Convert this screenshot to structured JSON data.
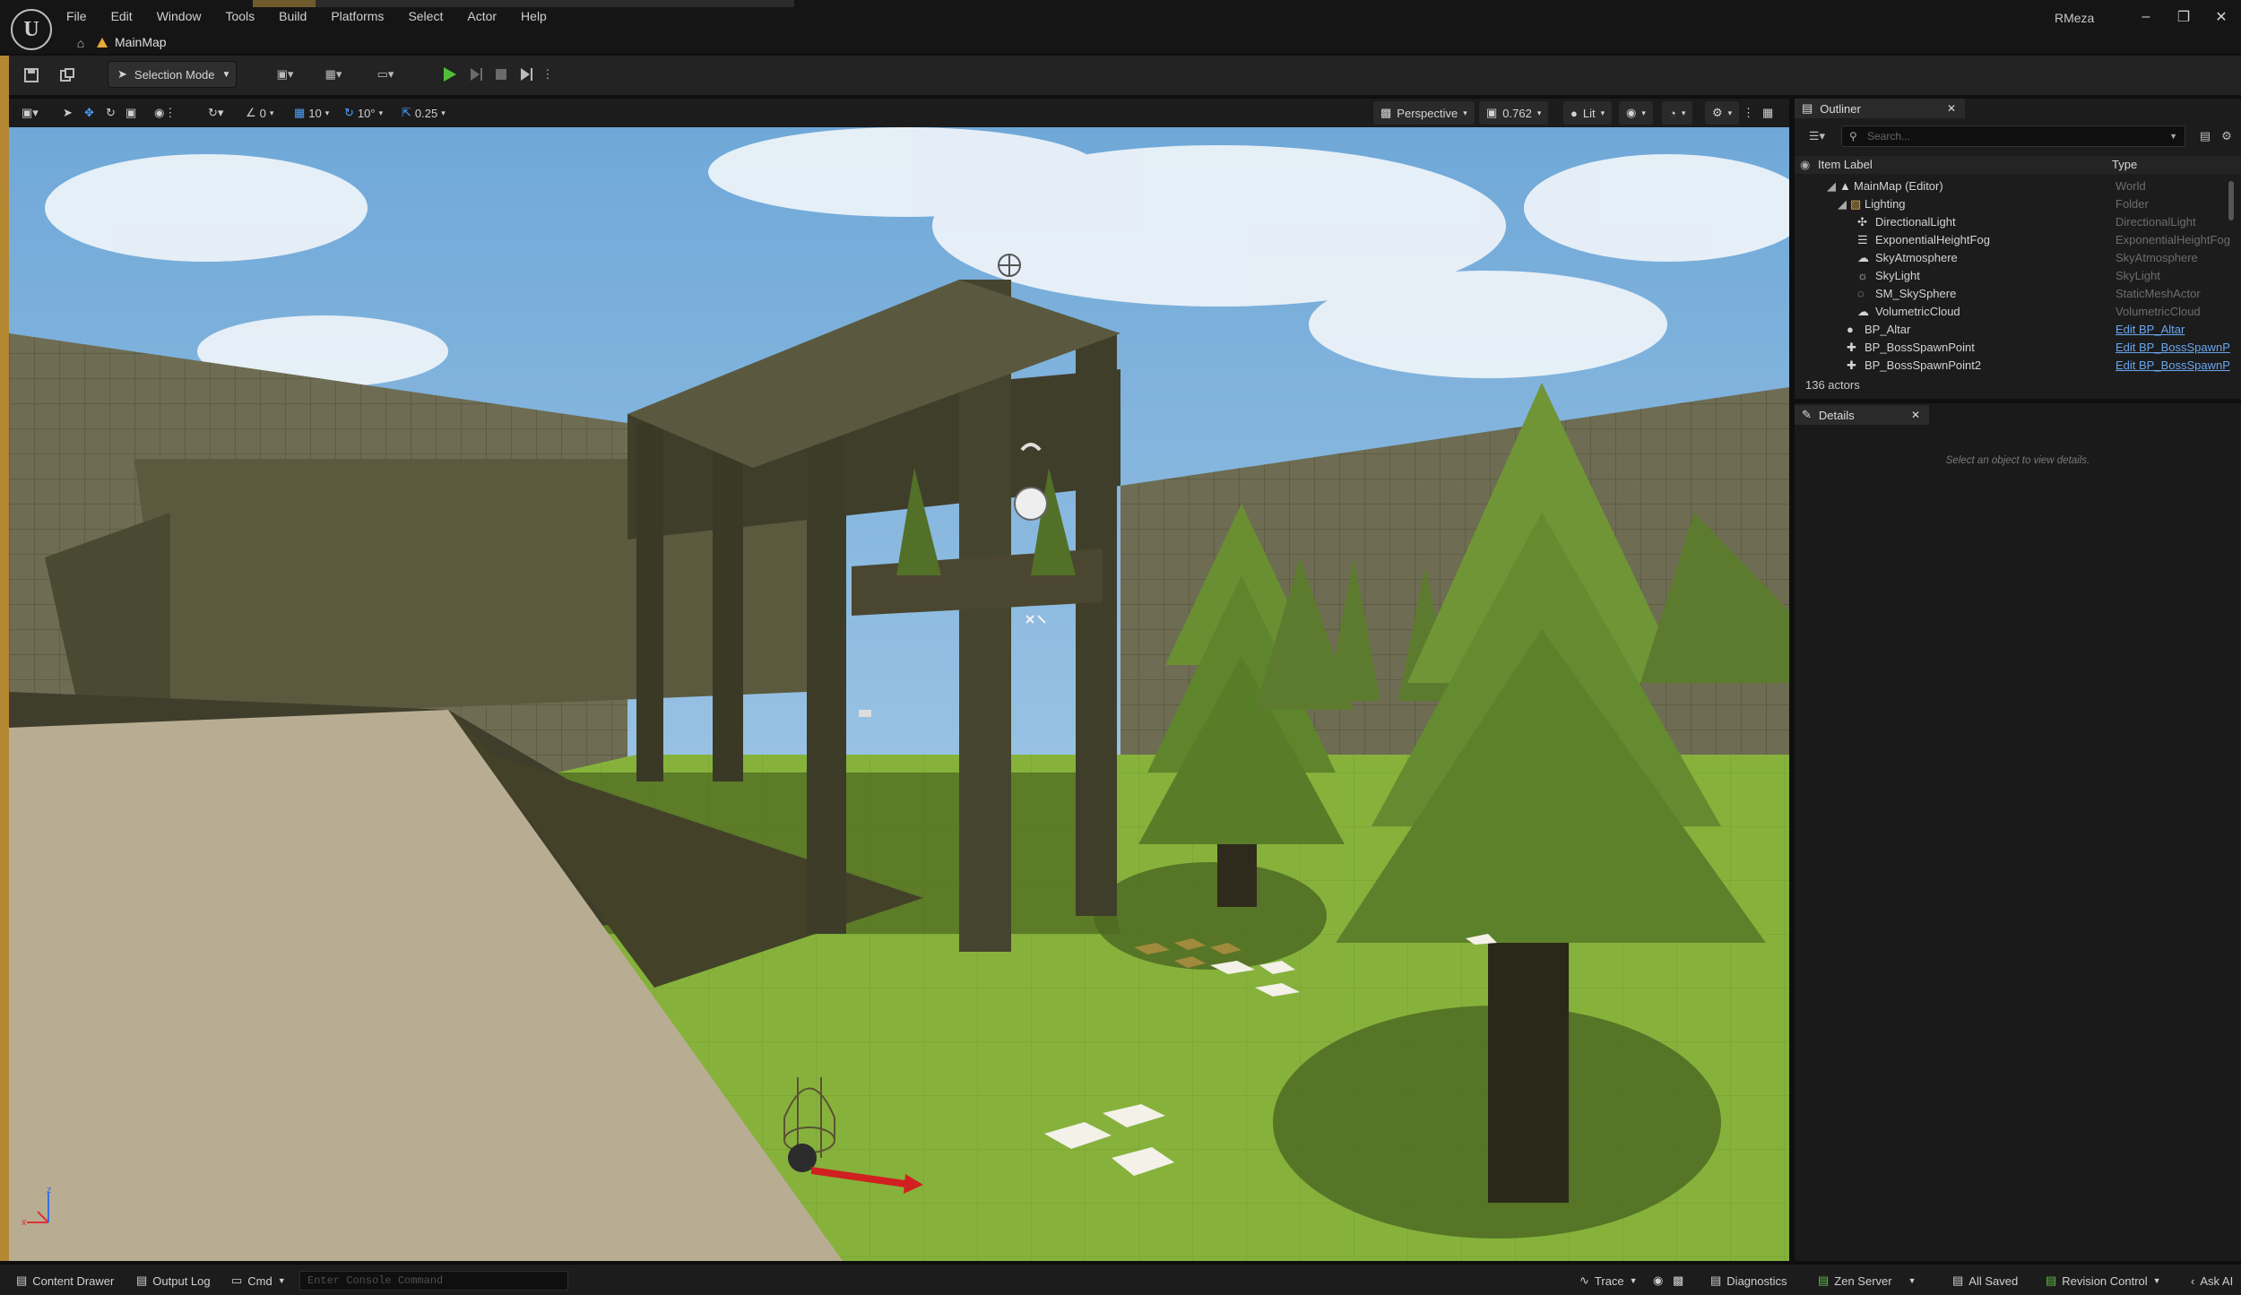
{
  "app": {
    "logo": "unreal-engine-logo",
    "user": "RMeza",
    "level_tab": "MainMap",
    "accent_color": "#e8a93a"
  },
  "menu": {
    "items": [
      "File",
      "Edit",
      "Window",
      "Tools",
      "Build",
      "Platforms",
      "Select",
      "Actor",
      "Help"
    ]
  },
  "toolbar": {
    "selection_mode": "Selection Mode"
  },
  "viewport_toolbar": {
    "snap_rotate_value": "0",
    "grid_snap": "10",
    "rotation_snap": "10°",
    "scale_snap": "0.25",
    "view_mode_perspective": "Perspective",
    "camera_speed": "0.762",
    "lighting_mode": "Lit"
  },
  "outliner": {
    "title": "Outliner",
    "search_placeholder": "Search...",
    "columns": {
      "label": "Item Label",
      "type": "Type"
    },
    "rows": [
      {
        "label": "MainMap (Editor)",
        "type": "World",
        "link": false
      },
      {
        "label": "Lighting",
        "type": "Folder",
        "link": false
      },
      {
        "label": "DirectionalLight",
        "type": "DirectionalLight",
        "link": false
      },
      {
        "label": "ExponentialHeightFog",
        "type": "ExponentialHeightFog",
        "link": false
      },
      {
        "label": "SkyAtmosphere",
        "type": "SkyAtmosphere",
        "link": false
      },
      {
        "label": "SkyLight",
        "type": "SkyLight",
        "link": false
      },
      {
        "label": "SM_SkySphere",
        "type": "StaticMeshActor",
        "link": false
      },
      {
        "label": "VolumetricCloud",
        "type": "VolumetricCloud",
        "link": false
      },
      {
        "label": "BP_Altar",
        "type": "Edit BP_Altar",
        "link": true
      },
      {
        "label": "BP_BossSpawnPoint",
        "type": "Edit BP_BossSpawnP",
        "link": true
      },
      {
        "label": "BP_BossSpawnPoint2",
        "type": "Edit BP_BossSpawnP",
        "link": true
      }
    ],
    "count": "136 actors"
  },
  "details": {
    "title": "Details",
    "empty_message": "Select an object to view details."
  },
  "statusbar": {
    "content_drawer": "Content Drawer",
    "output_log": "Output Log",
    "cmd": "Cmd",
    "console_placeholder": "Enter Console Command",
    "trace": "Trace",
    "diagnostics": "Diagnostics",
    "zen_server": "Zen Server",
    "all_saved": "All Saved",
    "revision_control": "Revision Control",
    "ask_ai": "Ask AI"
  },
  "gizmo_axes": {
    "z": "z",
    "x": "x"
  }
}
